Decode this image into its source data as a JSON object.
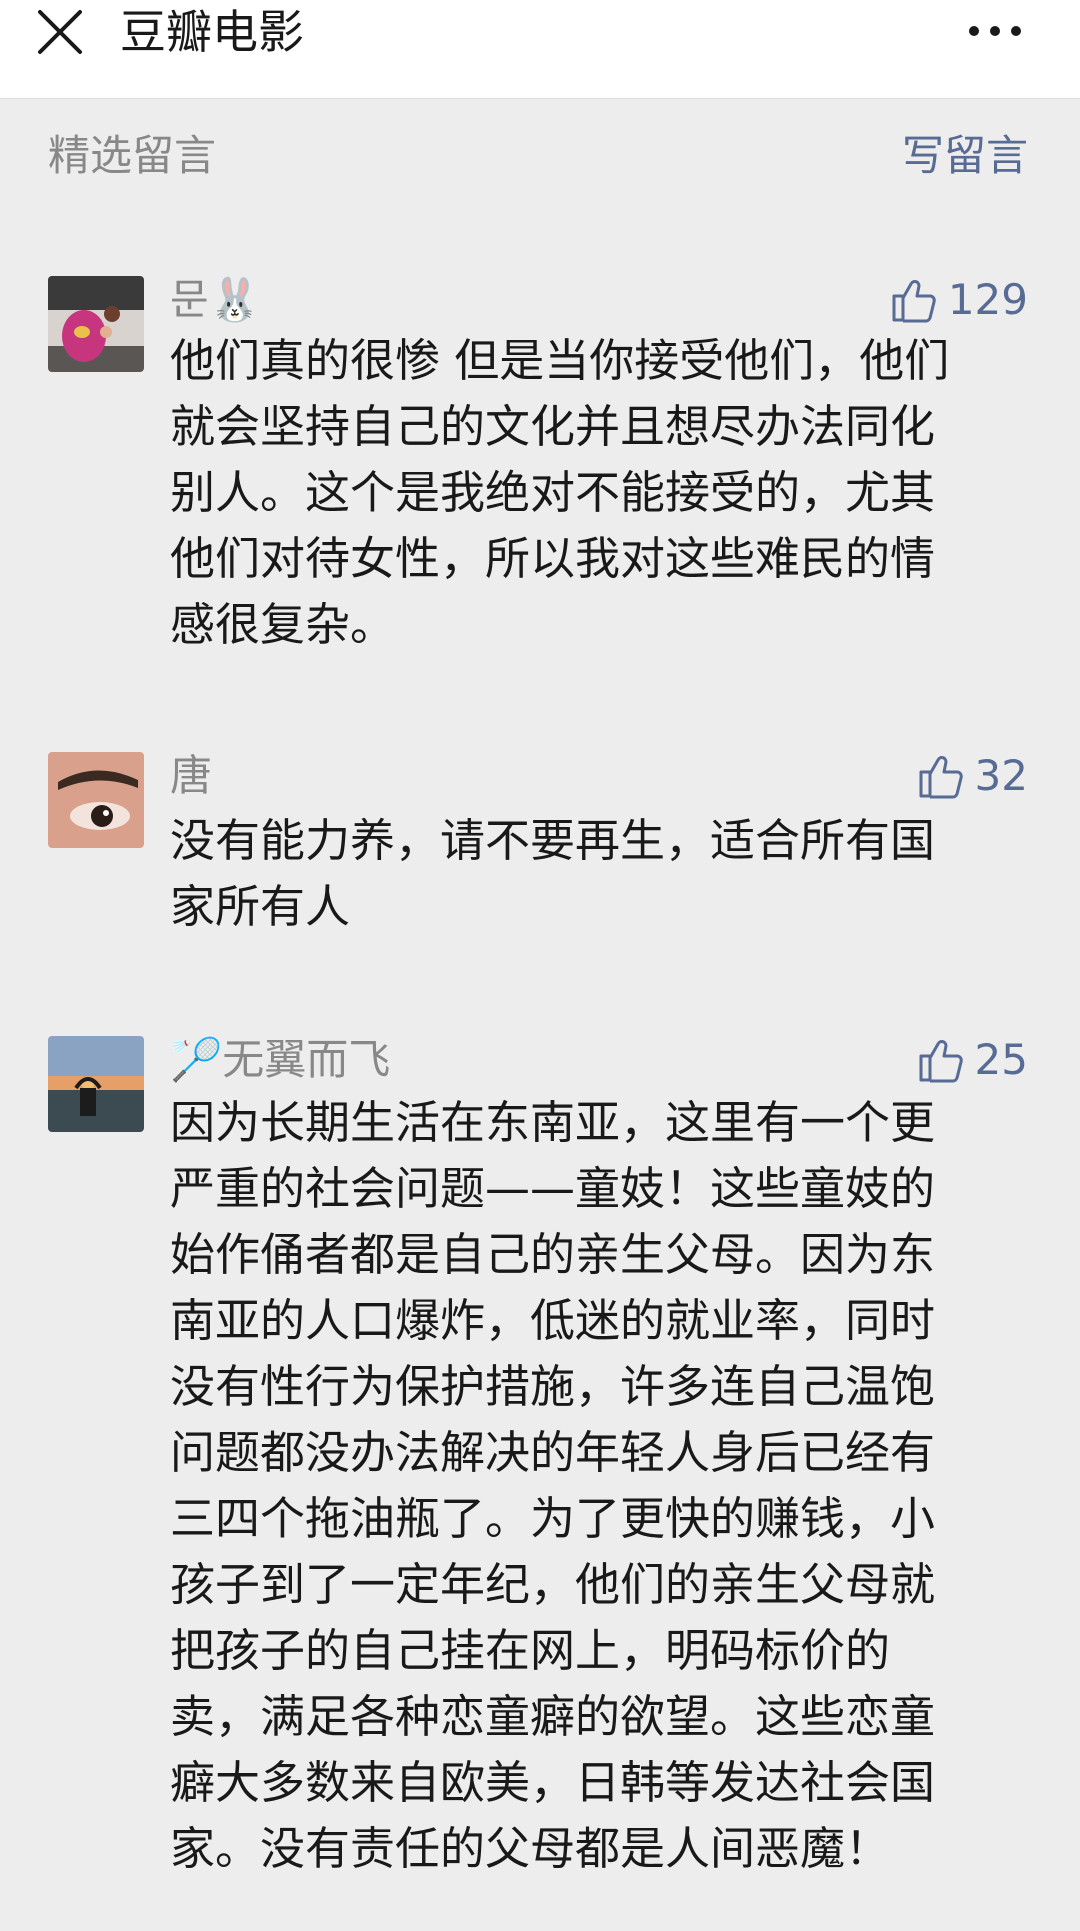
{
  "header": {
    "title": "豆瓣电影",
    "close_icon": "close-icon",
    "more_icon": "more-dots-icon"
  },
  "section": {
    "title": "精选留言",
    "write_label": "写留言"
  },
  "colors": {
    "link": "#576b95",
    "muted": "#888888",
    "text": "#191919",
    "background": "#ededed"
  },
  "comments": [
    {
      "nickname": "문🐰",
      "likes": "129",
      "content": "他们真的很惨 但是当你接受他们，他们\n就会坚持自己的文化并且想尽办法同化\n别人。这个是我绝对不能接受的，尤其\n他们对待女性，所以我对这些难民的情\n感很复杂。"
    },
    {
      "nickname": "唐",
      "likes": "32",
      "content": "没有能力养，请不要再生，适合所有国\n家所有人"
    },
    {
      "nickname": "🏸无翼而飞",
      "likes": "25",
      "content": "因为长期生活在东南亚，这里有一个更\n严重的社会问题——童妓！这些童妓的\n始作俑者都是自己的亲生父母。因为东\n南亚的人口爆炸，低迷的就业率，同时\n没有性行为保护措施，许多连自己温饱\n问题都没办法解决的年轻人身后已经有\n三四个拖油瓶了。为了更快的赚钱，小\n孩子到了一定年纪，他们的亲生父母就\n把孩子的自己挂在网上，明码标价的\n卖，满足各种恋童癖的欲望。这些恋童\n癖大多数来自欧美，日韩等发达社会国\n家。没有责任的父母都是人间恶魔！"
    }
  ]
}
